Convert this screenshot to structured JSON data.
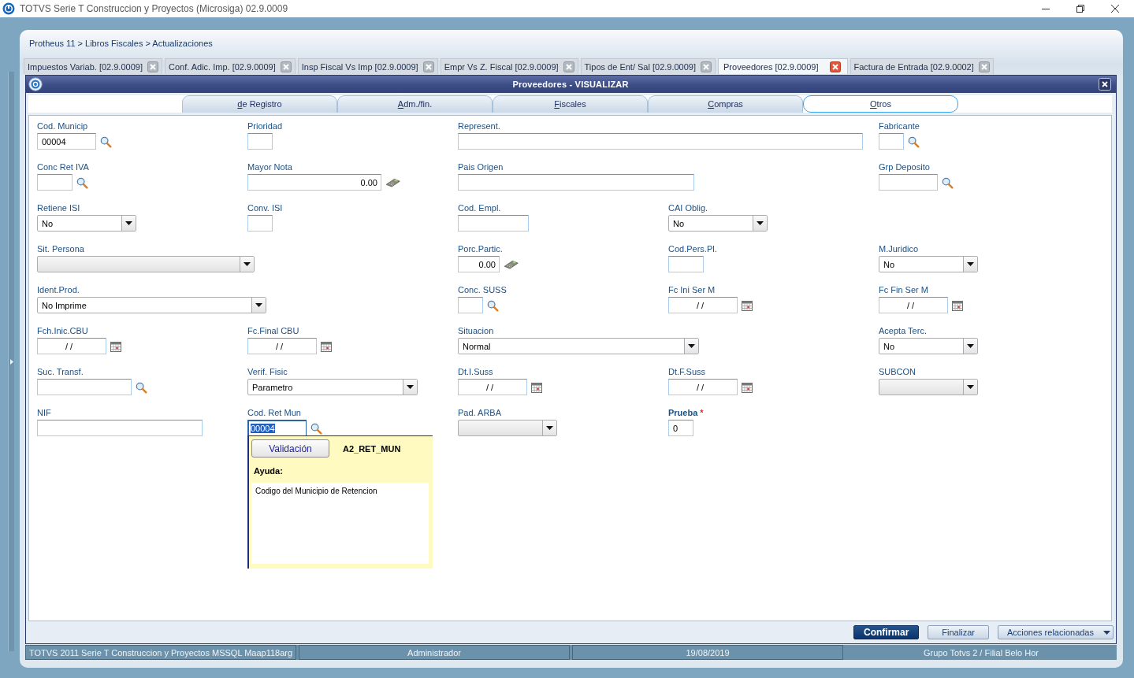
{
  "window": {
    "title": "TOTVS Serie T Construccion y Proyectos (Microsiga) 02.9.0009"
  },
  "breadcrumb": "Protheus 11 > Libros Fiscales > Actualizaciones",
  "doc_tabs": [
    {
      "label": "Impuestos Variab. [02.9.0009]",
      "selected": false
    },
    {
      "label": "Conf. Adic. Imp. [02.9.0009]",
      "selected": false
    },
    {
      "label": "Insp Fiscal Vs Imp [02.9.0009]",
      "selected": false
    },
    {
      "label": "Empr Vs Z. Fiscal [02.9.0009]",
      "selected": false
    },
    {
      "label": "Tipos de Ent/ Sal [02.9.0009]",
      "selected": false
    },
    {
      "label": "Proveedores [02.9.0009]",
      "selected": true
    },
    {
      "label": "Factura de Entrada [02.9.0002]",
      "selected": false
    }
  ],
  "dialog": {
    "title": "Proveedores - VISUALIZAR",
    "tabs": [
      {
        "label": "de Registro",
        "selected": false
      },
      {
        "label": "Adm./fin.",
        "selected": false
      },
      {
        "label": "Fiscales",
        "selected": false
      },
      {
        "label": "Compras",
        "selected": false
      },
      {
        "label": "Otros",
        "selected": true
      }
    ],
    "rows": [
      {
        "fields": [
          {
            "label": "Cod. Municip",
            "kind": "lookup",
            "value": "00004",
            "required": false,
            "focused": false
          },
          {
            "label": "Prioridad",
            "kind": "text",
            "required": false,
            "focused": false
          },
          {
            "label": "Represent.",
            "kind": "text",
            "required": false,
            "focused": false
          },
          {
            "label": "Fabricante",
            "kind": "lookup",
            "required": false,
            "focused": false
          }
        ]
      },
      {
        "fields": [
          {
            "label": "Conc Ret IVA",
            "kind": "lookup",
            "required": false,
            "focused": false
          },
          {
            "label": "Mayor Nota",
            "kind": "number",
            "value": "0.00",
            "required": false,
            "focused": false
          },
          {
            "label": "Pais Origen",
            "kind": "text",
            "required": false,
            "focused": false
          },
          {
            "label": "Grp Deposito",
            "kind": "lookup",
            "required": false,
            "focused": false
          }
        ]
      },
      {
        "fields": [
          {
            "label": "Retiene ISI",
            "kind": "select",
            "value": "No",
            "required": false,
            "focused": false
          },
          {
            "label": "Conv. ISI",
            "kind": "text",
            "required": false,
            "focused": false
          },
          {
            "label": "Cod. Empl.",
            "kind": "text",
            "required": false,
            "focused": false
          },
          {
            "label": "CAI Oblig.",
            "kind": "select",
            "value": "No",
            "required": false,
            "focused": false
          }
        ]
      },
      {
        "fields": [
          {
            "label": "Sit. Persona",
            "kind": "select",
            "required": false,
            "focused": false
          },
          {
            "label": "Porc.Partic.",
            "kind": "number",
            "value": "0.00",
            "required": false,
            "focused": false
          },
          {
            "label": "Cod.Pers.Pl.",
            "kind": "text",
            "required": false,
            "focused": false
          },
          {
            "label": "M.Juridico",
            "kind": "select",
            "value": "No",
            "required": false,
            "focused": false
          }
        ]
      },
      {
        "fields": [
          {
            "label": "Ident.Prod.",
            "kind": "select",
            "value": "No Imprime",
            "required": false,
            "focused": false
          },
          {
            "label": "Conc. SUSS",
            "kind": "lookup",
            "required": false,
            "focused": false
          },
          {
            "label": "Fc Ini Ser M",
            "kind": "date",
            "value": "/ /",
            "required": false,
            "focused": false
          },
          {
            "label": "Fc Fin Ser M",
            "kind": "date",
            "value": "/ /",
            "required": false,
            "focused": false
          }
        ]
      },
      {
        "fields": [
          {
            "label": "Fch.Inic.CBU",
            "kind": "date",
            "value": "/ /",
            "required": false,
            "focused": false
          },
          {
            "label": "Fc.Final CBU",
            "kind": "date",
            "value": "/ /",
            "required": false,
            "focused": false
          },
          {
            "label": "Situacion",
            "kind": "select",
            "value": "Normal",
            "required": false,
            "focused": false
          },
          {
            "label": "Acepta Terc.",
            "kind": "select",
            "value": "No",
            "required": false,
            "focused": false
          }
        ]
      },
      {
        "fields": [
          {
            "label": "Suc. Transf.",
            "kind": "lookup",
            "required": false,
            "focused": false
          },
          {
            "label": "Verif. Fisic",
            "kind": "select",
            "value": "Parametro",
            "required": false,
            "focused": false
          },
          {
            "label": "Dt.I.Suss",
            "kind": "date",
            "value": "/ /",
            "required": false,
            "focused": false
          },
          {
            "label": "Dt.F.Suss",
            "kind": "date",
            "value": "/ /",
            "required": false,
            "focused": false
          },
          {
            "label": "SUBCON",
            "kind": "select",
            "required": false,
            "focused": false
          }
        ]
      },
      {
        "fields": [
          {
            "label": "NIF",
            "kind": "text",
            "required": false,
            "focused": false
          },
          {
            "label": "Cod. Ret Mun",
            "kind": "lookup",
            "value": "00004",
            "required": false,
            "focused": true,
            "help_popup": {
              "button": "Validación",
              "field_code": "A2_RET_MUN",
              "heading": "Ayuda:",
              "text": "Codigo del Municipio de Retencion"
            }
          },
          {
            "label": "Pad. ARBA",
            "kind": "select",
            "required": false,
            "focused": false
          },
          {
            "label": "Prueba",
            "kind": "text",
            "value": "0",
            "required": true,
            "required_mark": "*",
            "focused": false
          }
        ]
      }
    ],
    "buttons": [
      {
        "label": "Confirmar",
        "kind": "primary"
      },
      {
        "label": "Finalizar",
        "kind": "plain"
      },
      {
        "label": "Acciones relacionadas",
        "kind": "menu"
      }
    ]
  },
  "status_bar": [
    "TOTVS 2011 Serie T Construccion y Proyectos MSSQL Maap118arg",
    "Administrador",
    "19/08/2019",
    "Grupo Totvs 2 / Filial Belo Hor"
  ]
}
